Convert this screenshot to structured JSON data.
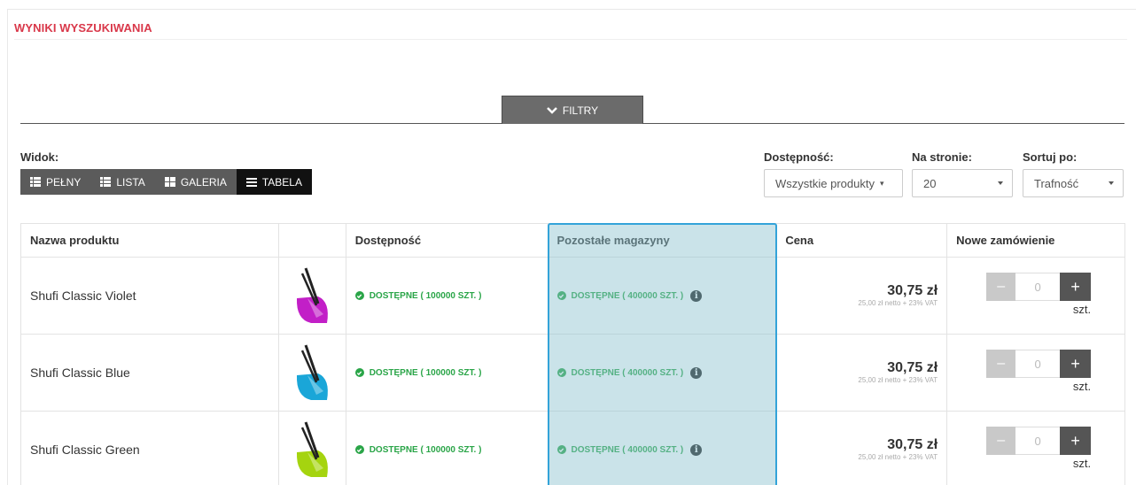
{
  "section_title": "WYNIKI WYSZUKIWANIA",
  "filter_button": {
    "label": "FILTRY",
    "icon": "chevron-down-icon"
  },
  "view": {
    "label": "Widok:",
    "buttons": [
      {
        "label": "PEŁNY",
        "icon": "list-full-icon",
        "active": false
      },
      {
        "label": "LISTA",
        "icon": "list-icon",
        "active": false
      },
      {
        "label": "GALERIA",
        "icon": "grid-icon",
        "active": false
      },
      {
        "label": "TABELA",
        "icon": "table-icon",
        "active": true
      }
    ]
  },
  "availability_filter": {
    "label": "Dostępność:",
    "value": "Wszystkie produkty"
  },
  "per_page": {
    "label": "Na stronie:",
    "value": "20"
  },
  "sort": {
    "label": "Sortuj po:",
    "value": "Trafność"
  },
  "table": {
    "headers": [
      "Nazwa produktu",
      "",
      "Dostępność",
      "Pozostałe magazyny",
      "Cena",
      "Nowe zamówienie"
    ],
    "rows": [
      {
        "name": "Shufi Classic Violet",
        "image_color": "#c21fc7",
        "availability": "DOSTĘPNE ( 100000 SZT. )",
        "other_warehouses": "DOSTĘPNE ( 400000 SZT. )",
        "price": "30,75 zł",
        "price_net": "25,00 zł netto + 23% VAT",
        "qty": "0",
        "unit": "szt."
      },
      {
        "name": "Shufi Classic Blue",
        "image_color": "#1aa6d8",
        "availability": "DOSTĘPNE ( 100000 SZT. )",
        "other_warehouses": "DOSTĘPNE ( 400000 SZT. )",
        "price": "30,75 zł",
        "price_net": "25,00 zł netto + 23% VAT",
        "qty": "0",
        "unit": "szt."
      },
      {
        "name": "Shufi Classic Green",
        "image_color": "#a5d40f",
        "availability": "DOSTĘPNE ( 100000 SZT. )",
        "other_warehouses": "DOSTĘPNE ( 400000 SZT. )",
        "price": "30,75 zł",
        "price_net": "25,00 zł netto + 23% VAT",
        "qty": "0",
        "unit": "szt."
      }
    ]
  },
  "colors": {
    "accent_red": "#d9384a",
    "available_green": "#2aa548",
    "highlight_border": "#33a3d9"
  }
}
